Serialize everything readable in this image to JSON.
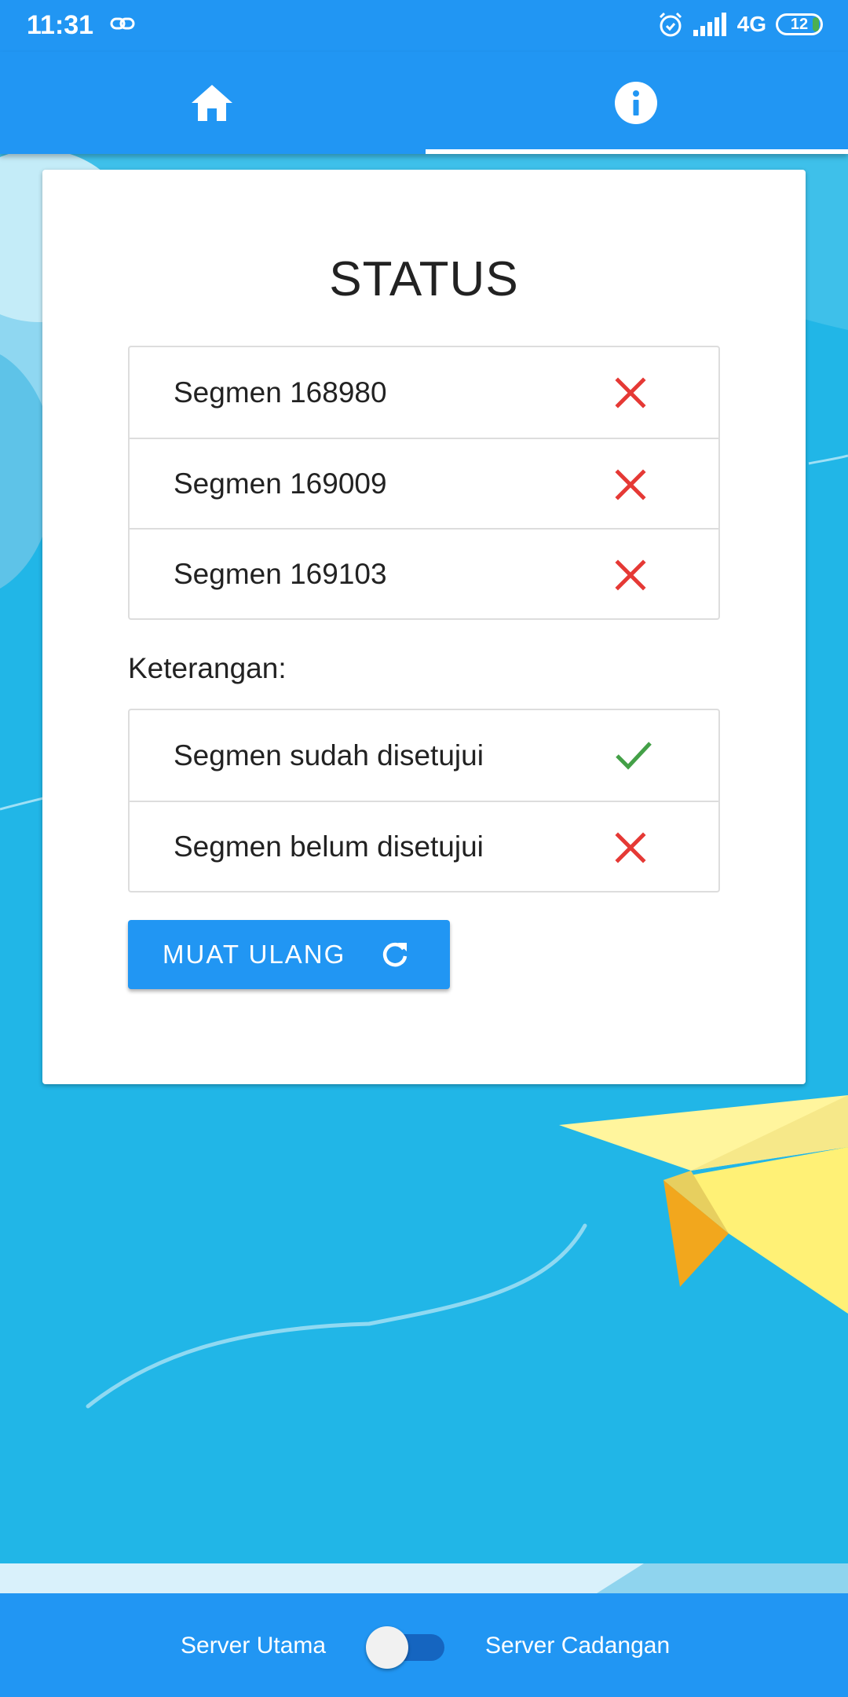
{
  "status_bar": {
    "time": "11:31",
    "network": "4G",
    "battery": "12",
    "icons": [
      "link-icon",
      "alarm-icon",
      "signal-icon",
      "battery-icon"
    ]
  },
  "tabs": [
    {
      "name": "home",
      "icon": "home-icon",
      "selected": false
    },
    {
      "name": "info",
      "icon": "info-icon",
      "selected": true
    }
  ],
  "card": {
    "title": "STATUS",
    "segments": [
      {
        "label": "Segmen 168980",
        "approved": false
      },
      {
        "label": "Segmen 169009",
        "approved": false
      },
      {
        "label": "Segmen 169103",
        "approved": false
      }
    ],
    "legend_heading": "Keterangan:",
    "legend": [
      {
        "label": "Segmen sudah disetujui",
        "icon": "check-icon"
      },
      {
        "label": "Segmen belum disetujui",
        "icon": "cross-icon"
      }
    ],
    "reload_button": "MUAT ULANG"
  },
  "bottom_bar": {
    "primary_server": "Server Utama",
    "backup_server": "Server Cadangan",
    "switch_on_backup": false
  },
  "colors": {
    "primary": "#2196f3",
    "background": "#21b6e7",
    "cross": "#e53935",
    "check": "#43a047"
  }
}
